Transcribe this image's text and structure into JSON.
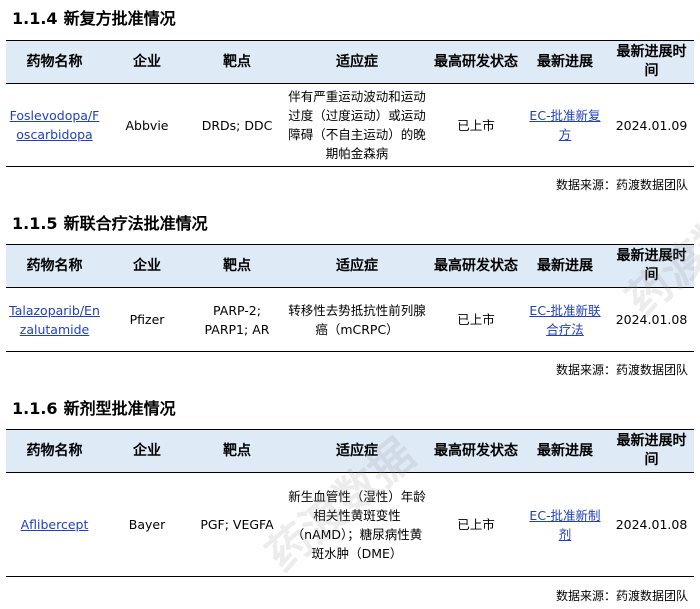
{
  "headers": [
    "药物名称",
    "企业",
    "靶点",
    "适应症",
    "最高研发状态",
    "最新进展",
    "最新进展时间"
  ],
  "sections": [
    {
      "number": "1.1.4",
      "title": "新复方批准情况",
      "row": {
        "drug": "Foslevodopa/Foscarbidopa",
        "company": "Abbvie",
        "target": "DRDs; DDC",
        "indication": "伴有严重运动波动和运动过度（过度运动）或运动障碍（不自主运动）的晚期帕金森病",
        "status": "已上市",
        "progress": "EC-批准新复方",
        "date": "2024.01.09"
      },
      "source": "数据来源：药渡数据团队"
    },
    {
      "number": "1.1.5",
      "title": "新联合疗法批准情况",
      "row": {
        "drug": "Talazoparib/Enzalutamide",
        "company": "Pfizer",
        "target": "PARP-2; PARP1; AR",
        "indication": "转移性去势抵抗性前列腺癌（mCRPC）",
        "status": "已上市",
        "progress": "EC-批准新联合疗法",
        "date": "2024.01.08"
      },
      "source": "数据来源：药渡数据团队"
    },
    {
      "number": "1.1.6",
      "title": "新剂型批准情况",
      "row": {
        "drug": "Aflibercept",
        "company": "Bayer",
        "target": "PGF; VEGFA",
        "indication": "新生血管性（湿性）年龄相关性黄斑变性（nAMD）；糖尿病性黄斑水肿（DME）",
        "status": "已上市",
        "progress": "EC-批准新制剂",
        "date": "2024.01.08"
      },
      "source": "数据来源：药渡数据团队"
    }
  ],
  "watermark": "药渡数据"
}
